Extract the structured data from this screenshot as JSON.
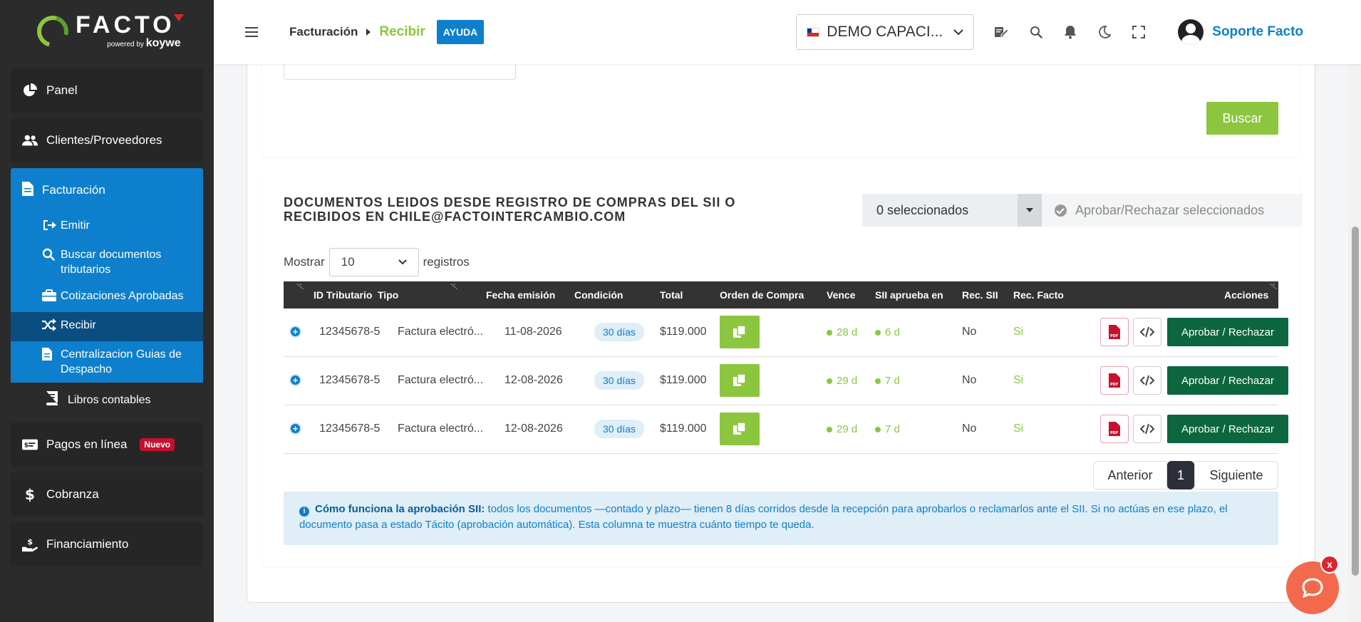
{
  "brand": {
    "name": "FACTO",
    "powered": "powered",
    "by": "by",
    "koywe": "koywe"
  },
  "sidebar": {
    "panel": "Panel",
    "clientes": "Clientes/Proveedores",
    "facturacion": "Facturación",
    "sub": {
      "emitir": "Emitir",
      "buscar": "Buscar documentos tributarios",
      "cotizaciones": "Cotizaciones Aprobadas",
      "recibir": "Recibir",
      "centralizacion": "Centralizacion Guias de Despacho",
      "libros": "Libros contables"
    },
    "pagos": "Pagos en línea",
    "pagos_badge": "Nuevo",
    "cobranza": "Cobranza",
    "financiamiento": "Financiamiento"
  },
  "topbar": {
    "breadcrumb_parent": "Facturación",
    "breadcrumb_current": "Recibir",
    "help": "AYUDA",
    "company": "DEMO CAPACI...",
    "user": "Soporte Facto"
  },
  "search": {
    "button": "Buscar"
  },
  "documents": {
    "title": "DOCUMENTOS LEIDOS DESDE REGISTRO DE COMPRAS DEL SII O RECIBIDOS EN CHILE@FACTOINTERCAMBIO.COM",
    "selected": "0 seleccionados",
    "approve_selected": "Aprobar/Rechazar seleccionados",
    "show_label": "Mostrar",
    "show_value": "10",
    "records_label": "registros",
    "columns": {
      "id": "ID Tributario",
      "tipo": "Tipo",
      "fecha": "Fecha emisión",
      "condicion": "Condición",
      "total": "Total",
      "orden": "Orden de Compra",
      "vence": "Vence",
      "sii": "SII aprueba en",
      "recsii": "Rec. SII",
      "recfacto": "Rec. Facto",
      "acciones": "Acciones"
    },
    "rows": [
      {
        "id": "12345678-5",
        "tipo": "Factura electró...",
        "fecha": "11-08-2026",
        "condicion": "30 días",
        "total": "$119.000",
        "vence": "28 d",
        "sii": "6 d",
        "recsii": "No",
        "recfacto": "Si",
        "action": "Aprobar / Rechazar"
      },
      {
        "id": "12345678-5",
        "tipo": "Factura electró...",
        "fecha": "12-08-2026",
        "condicion": "30 días",
        "total": "$119.000",
        "vence": "29 d",
        "sii": "7 d",
        "recsii": "No",
        "recfacto": "Si",
        "action": "Aprobar / Rechazar"
      },
      {
        "id": "12345678-5",
        "tipo": "Factura electró...",
        "fecha": "12-08-2026",
        "condicion": "30 días",
        "total": "$119.000",
        "vence": "29 d",
        "sii": "7 d",
        "recsii": "No",
        "recfacto": "Si",
        "action": "Aprobar / Rechazar"
      }
    ],
    "pager": {
      "prev": "Anterior",
      "current": "1",
      "next": "Siguiente"
    },
    "info_title": "Cómo funciona la aprobación SII:",
    "info_text": " todos los documentos —contado y plazo— tienen 8 días corridos desde la recepción para aprobarlos o reclamarlos ante el SII. Si no actúas en ese plazo, el documento pasa a estado Tácito (aprobación automática). Esta columna te muestra cuánto tiempo te queda."
  },
  "chat": {
    "close": "x"
  },
  "colors": {
    "green": "#8cc63f",
    "blue": "#0d7fcc",
    "dark_green": "#0c6640",
    "sidebar": "#2b2b2b"
  }
}
